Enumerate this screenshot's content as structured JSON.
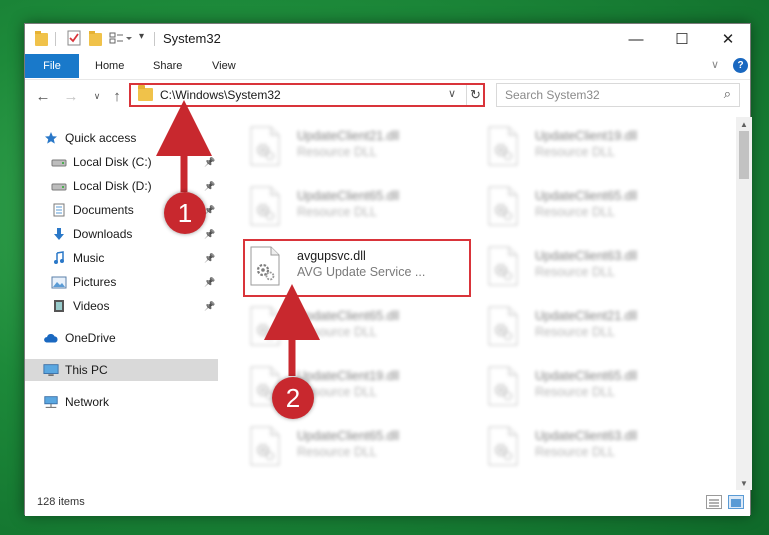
{
  "window": {
    "title": "System32",
    "controls": {
      "minimize": "—",
      "maximize": "☐",
      "close": "✕"
    }
  },
  "ribbon": {
    "file_tab": "File",
    "tabs": [
      "Home",
      "Share",
      "View"
    ]
  },
  "nav": {
    "address": "C:\\Windows\\System32",
    "search_placeholder": "Search System32"
  },
  "sidebar": {
    "items": [
      {
        "label": "Quick access",
        "icon": "star-icon"
      },
      {
        "label": "Local Disk (C:)",
        "icon": "drive-icon",
        "pinned": true
      },
      {
        "label": "Local Disk (D:)",
        "icon": "drive-icon",
        "pinned": true
      },
      {
        "label": "Documents",
        "icon": "documents-icon",
        "pinned": true
      },
      {
        "label": "Downloads",
        "icon": "download-icon",
        "pinned": true
      },
      {
        "label": "Music",
        "icon": "music-icon",
        "pinned": true
      },
      {
        "label": "Pictures",
        "icon": "pictures-icon",
        "pinned": true
      },
      {
        "label": "Videos",
        "icon": "videos-icon",
        "pinned": true
      },
      {
        "label": "OneDrive",
        "icon": "cloud-icon"
      },
      {
        "label": "This PC",
        "icon": "computer-icon",
        "selected": true
      },
      {
        "label": "Network",
        "icon": "network-icon"
      }
    ]
  },
  "files": [
    {
      "name": "UpdateClient21.dll",
      "type": "Resource DLL",
      "blurred": true
    },
    {
      "name": "UpdateClient19.dll",
      "type": "Resource DLL",
      "blurred": true
    },
    {
      "name": "UpdateClient65.dll",
      "type": "Resource DLL",
      "blurred": true
    },
    {
      "name": "UpdateClient65.dll",
      "type": "Resource DLL",
      "blurred": true
    },
    {
      "name": "avgupsvc.dll",
      "type": "AVG Update Service ...",
      "blurred": false
    },
    {
      "name": "UpdateClient63.dll",
      "type": "Resource DLL",
      "blurred": true
    },
    {
      "name": "UpdateClient65.dll",
      "type": "Resource DLL",
      "blurred": true
    },
    {
      "name": "UpdateClient21.dll",
      "type": "Resource DLL",
      "blurred": true
    },
    {
      "name": "UpdateClient19.dll",
      "type": "Resource DLL",
      "blurred": true
    },
    {
      "name": "UpdateClient65.dll",
      "type": "Resource DLL",
      "blurred": true
    },
    {
      "name": "UpdateClient65.dll",
      "type": "Resource DLL",
      "blurred": true
    },
    {
      "name": "UpdateClient63.dll",
      "type": "Resource DLL",
      "blurred": true
    }
  ],
  "status": {
    "item_count": "128 items"
  },
  "annotations": {
    "marker_1": "1",
    "marker_2": "2"
  },
  "colors": {
    "accent": "#1979ca",
    "highlight": "#d9343a",
    "marker": "#c8282e"
  }
}
